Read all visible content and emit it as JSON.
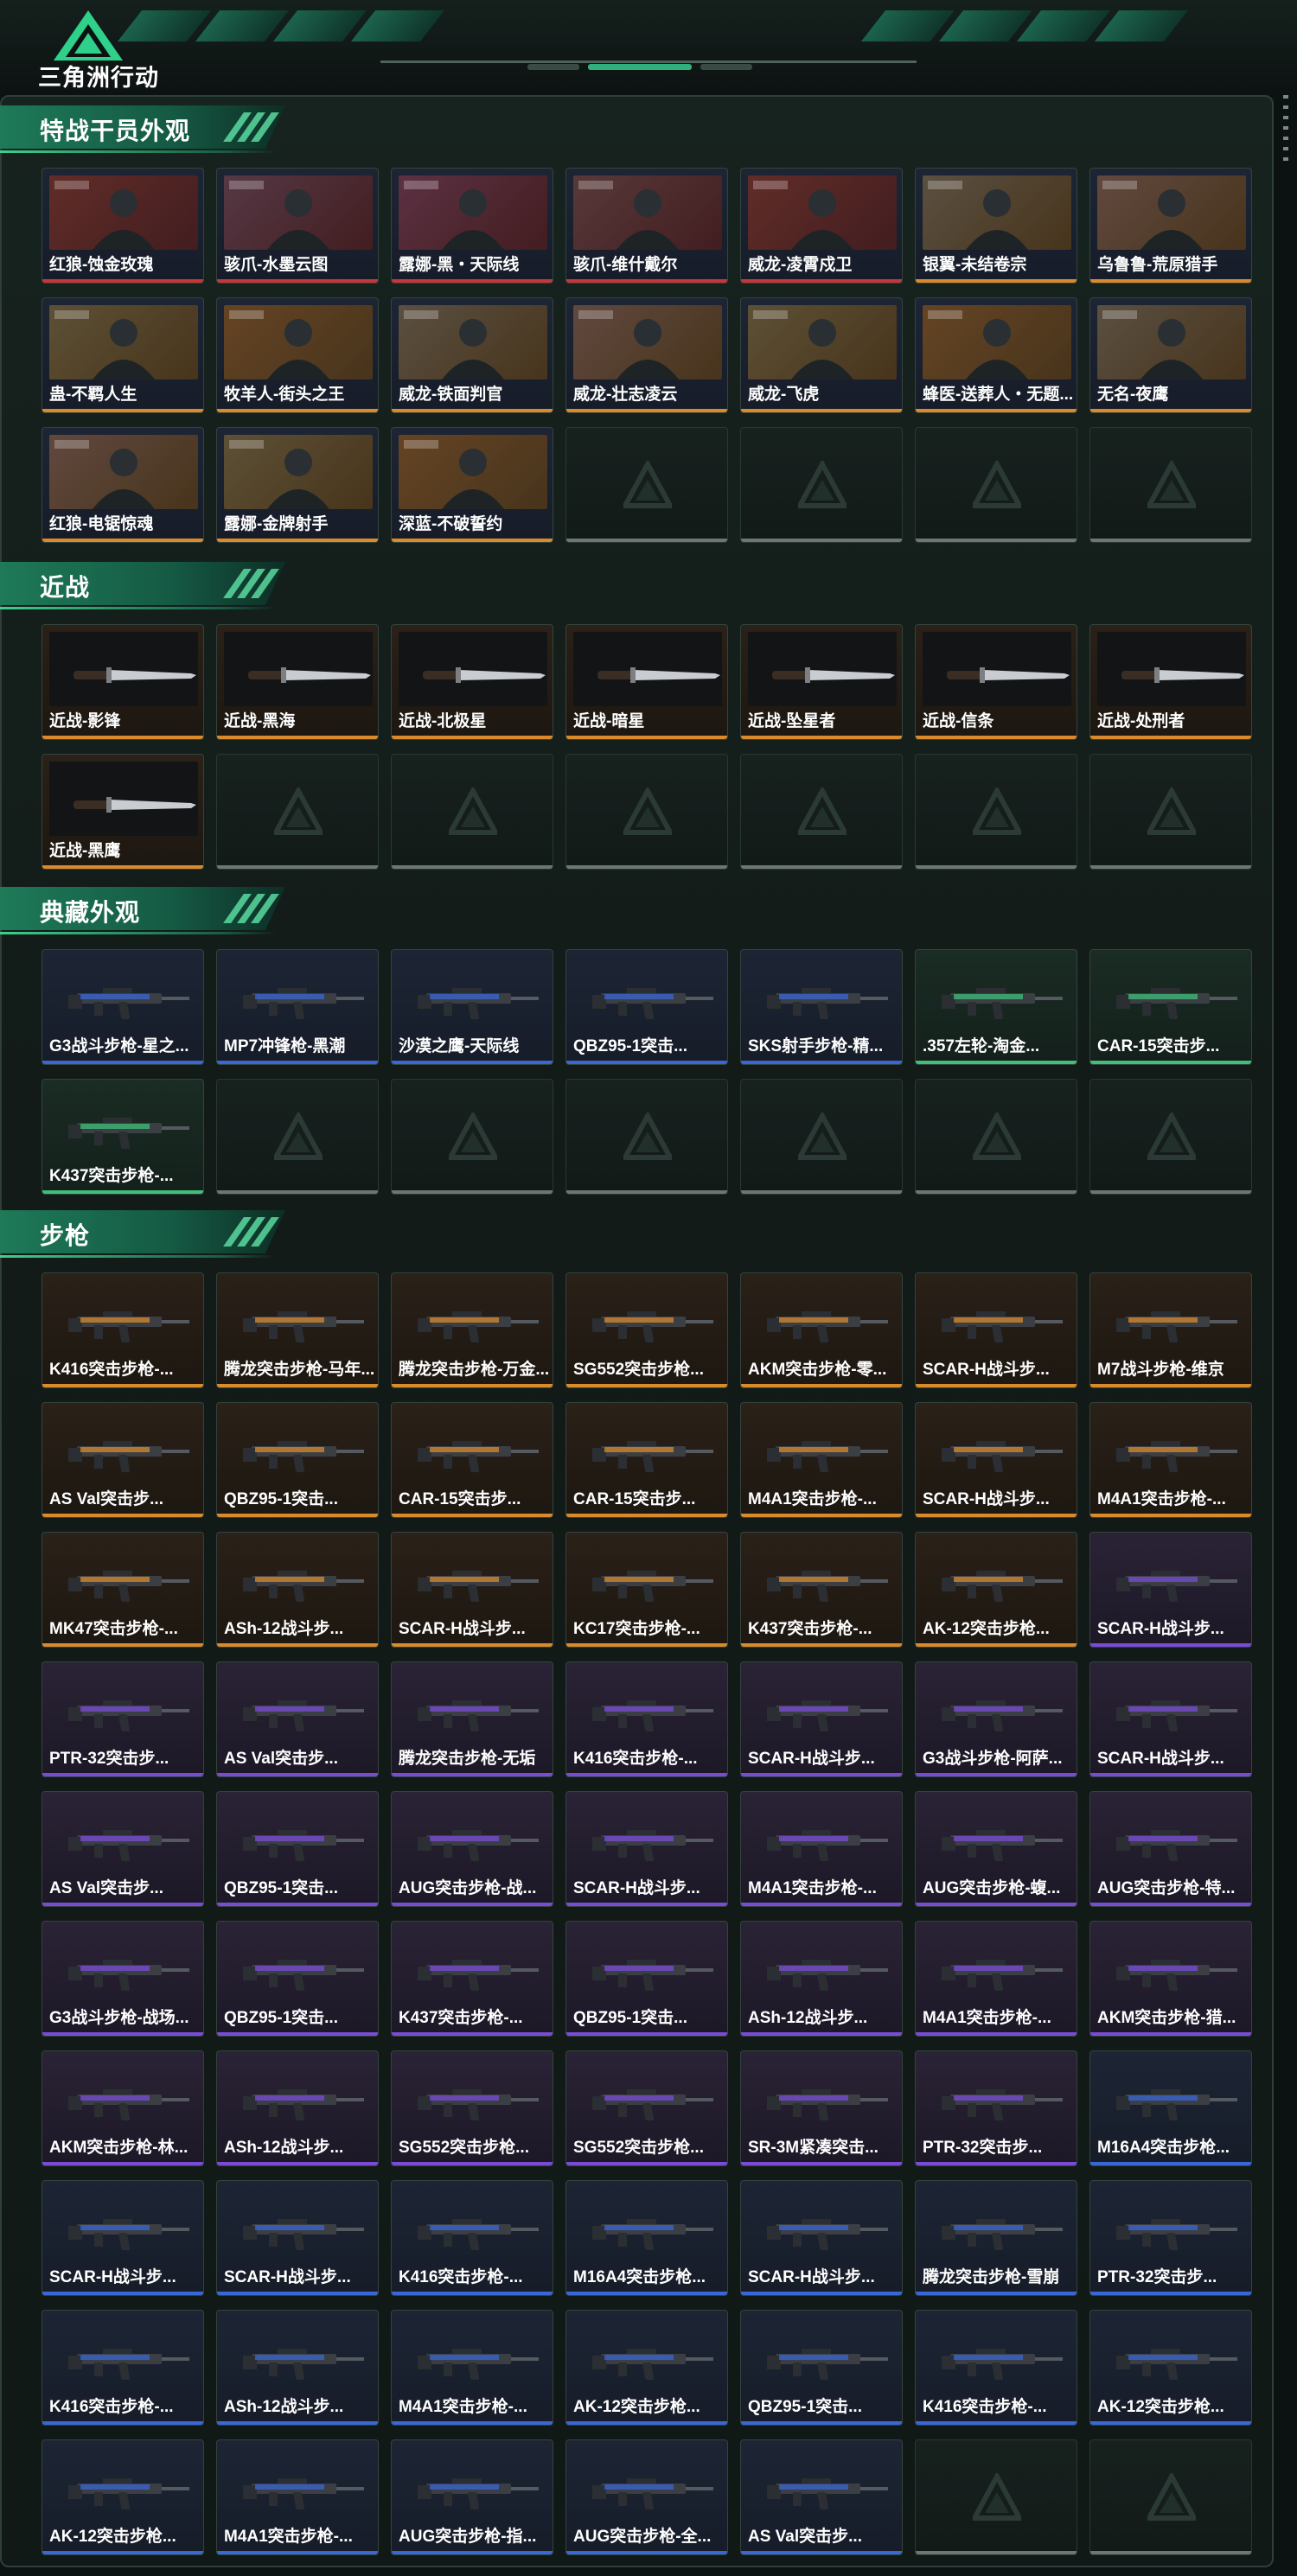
{
  "brand": {
    "name": "三角洲行动"
  },
  "colors": {
    "gold": "#d98a2b",
    "purple": "#7a4cd6",
    "blue": "#3a67d6",
    "green": "#3fbf7a",
    "red": "#c7373a",
    "white": "#b8c2bf"
  },
  "sections": [
    {
      "title": "特战干员外观",
      "kind": "operator",
      "items": [
        {
          "label": "红狼-蚀金玫瑰",
          "rarity": "red",
          "thumb": "portrait"
        },
        {
          "label": "骇爪-水墨云图",
          "rarity": "red",
          "thumb": "portrait"
        },
        {
          "label": "露娜-黑・天际线",
          "rarity": "red",
          "thumb": "portrait"
        },
        {
          "label": "骇爪-维什戴尔",
          "rarity": "red",
          "thumb": "portrait"
        },
        {
          "label": "威龙-凌霄戍卫",
          "rarity": "red",
          "thumb": "portrait"
        },
        {
          "label": "银翼-未结卷宗",
          "rarity": "gold",
          "thumb": "portrait"
        },
        {
          "label": "乌鲁鲁-荒原猎手",
          "rarity": "gold",
          "thumb": "portrait"
        },
        {
          "label": "蛊-不羁人生",
          "rarity": "gold",
          "thumb": "portrait"
        },
        {
          "label": "牧羊人-街头之王",
          "rarity": "gold",
          "thumb": "portrait"
        },
        {
          "label": "威龙-铁面判官",
          "rarity": "gold",
          "thumb": "portrait"
        },
        {
          "label": "威龙-壮志凌云",
          "rarity": "gold",
          "thumb": "portrait"
        },
        {
          "label": "威龙-飞虎",
          "rarity": "gold",
          "thumb": "portrait"
        },
        {
          "label": "蜂医-送葬人・无题...",
          "rarity": "gold",
          "thumb": "portrait"
        },
        {
          "label": "无名-夜鹰",
          "rarity": "gold",
          "thumb": "portrait"
        },
        {
          "label": "红狼-电锯惊魂",
          "rarity": "gold",
          "thumb": "portrait"
        },
        {
          "label": "露娜-金牌射手",
          "rarity": "gold",
          "thumb": "portrait"
        },
        {
          "label": "深蓝-不破誓约",
          "rarity": "gold",
          "thumb": "portrait"
        }
      ],
      "empties": 4
    },
    {
      "title": "近战",
      "kind": "knife",
      "items": [
        {
          "label": "近战-影锋",
          "rarity": "gold"
        },
        {
          "label": "近战-黑海",
          "rarity": "gold"
        },
        {
          "label": "近战-北极星",
          "rarity": "gold"
        },
        {
          "label": "近战-暗星",
          "rarity": "gold"
        },
        {
          "label": "近战-坠星者",
          "rarity": "gold"
        },
        {
          "label": "近战-信条",
          "rarity": "gold"
        },
        {
          "label": "近战-处刑者",
          "rarity": "gold"
        },
        {
          "label": "近战-黑鹰",
          "rarity": "gold"
        }
      ],
      "empties": 6
    },
    {
      "title": "典藏外观",
      "kind": "gun",
      "items": [
        {
          "label": "G3战斗步枪-星之...",
          "rarity": "blue"
        },
        {
          "label": "MP7冲锋枪-黑潮",
          "rarity": "blue"
        },
        {
          "label": "沙漠之鹰-天际线",
          "rarity": "blue"
        },
        {
          "label": "QBZ95-1突击...",
          "rarity": "blue"
        },
        {
          "label": "SKS射手步枪-精...",
          "rarity": "blue"
        },
        {
          "label": ".357左轮-淘金...",
          "rarity": "green"
        },
        {
          "label": "CAR-15突击步...",
          "rarity": "green"
        },
        {
          "label": "K437突击步枪-...",
          "rarity": "green"
        }
      ],
      "empties": 6
    },
    {
      "title": "步枪",
      "kind": "gun",
      "items": [
        {
          "label": "K416突击步枪-...",
          "rarity": "gold"
        },
        {
          "label": "腾龙突击步枪-马年...",
          "rarity": "gold"
        },
        {
          "label": "腾龙突击步枪-万金...",
          "rarity": "gold"
        },
        {
          "label": "SG552突击步枪...",
          "rarity": "gold"
        },
        {
          "label": "AKM突击步枪-零...",
          "rarity": "gold"
        },
        {
          "label": "SCAR-H战斗步...",
          "rarity": "gold"
        },
        {
          "label": "M7战斗步枪-维京",
          "rarity": "gold"
        },
        {
          "label": "AS Val突击步...",
          "rarity": "gold"
        },
        {
          "label": "QBZ95-1突击...",
          "rarity": "gold"
        },
        {
          "label": "CAR-15突击步...",
          "rarity": "gold"
        },
        {
          "label": "CAR-15突击步...",
          "rarity": "gold"
        },
        {
          "label": "M4A1突击步枪-...",
          "rarity": "gold"
        },
        {
          "label": "SCAR-H战斗步...",
          "rarity": "gold"
        },
        {
          "label": "M4A1突击步枪-...",
          "rarity": "gold"
        },
        {
          "label": "MK47突击步枪-...",
          "rarity": "gold"
        },
        {
          "label": "ASh-12战斗步...",
          "rarity": "gold"
        },
        {
          "label": "SCAR-H战斗步...",
          "rarity": "gold"
        },
        {
          "label": "KC17突击步枪-...",
          "rarity": "gold"
        },
        {
          "label": "K437突击步枪-...",
          "rarity": "gold"
        },
        {
          "label": "AK-12突击步枪...",
          "rarity": "gold"
        },
        {
          "label": "SCAR-H战斗步...",
          "rarity": "purple"
        },
        {
          "label": "PTR-32突击步...",
          "rarity": "purple"
        },
        {
          "label": "AS Val突击步...",
          "rarity": "purple"
        },
        {
          "label": "腾龙突击步枪-无垢",
          "rarity": "purple"
        },
        {
          "label": "K416突击步枪-...",
          "rarity": "purple"
        },
        {
          "label": "SCAR-H战斗步...",
          "rarity": "purple"
        },
        {
          "label": "G3战斗步枪-阿萨...",
          "rarity": "purple"
        },
        {
          "label": "SCAR-H战斗步...",
          "rarity": "purple"
        },
        {
          "label": "AS Val突击步...",
          "rarity": "purple"
        },
        {
          "label": "QBZ95-1突击...",
          "rarity": "purple"
        },
        {
          "label": "AUG突击步枪-战...",
          "rarity": "purple"
        },
        {
          "label": "SCAR-H战斗步...",
          "rarity": "purple"
        },
        {
          "label": "M4A1突击步枪-...",
          "rarity": "purple"
        },
        {
          "label": "AUG突击步枪-蝮...",
          "rarity": "purple"
        },
        {
          "label": "AUG突击步枪-特...",
          "rarity": "purple"
        },
        {
          "label": "G3战斗步枪-战场...",
          "rarity": "purple"
        },
        {
          "label": "QBZ95-1突击...",
          "rarity": "purple"
        },
        {
          "label": "K437突击步枪-...",
          "rarity": "purple"
        },
        {
          "label": "QBZ95-1突击...",
          "rarity": "purple"
        },
        {
          "label": "ASh-12战斗步...",
          "rarity": "purple"
        },
        {
          "label": "M4A1突击步枪-...",
          "rarity": "purple"
        },
        {
          "label": "AKM突击步枪-猎...",
          "rarity": "purple"
        },
        {
          "label": "AKM突击步枪-林...",
          "rarity": "purple"
        },
        {
          "label": "ASh-12战斗步...",
          "rarity": "purple"
        },
        {
          "label": "SG552突击步枪...",
          "rarity": "purple"
        },
        {
          "label": "SG552突击步枪...",
          "rarity": "purple"
        },
        {
          "label": "SR-3M紧凑突击...",
          "rarity": "purple"
        },
        {
          "label": "PTR-32突击步...",
          "rarity": "purple"
        },
        {
          "label": "M16A4突击步枪...",
          "rarity": "blue"
        },
        {
          "label": "SCAR-H战斗步...",
          "rarity": "blue"
        },
        {
          "label": "SCAR-H战斗步...",
          "rarity": "blue"
        },
        {
          "label": "K416突击步枪-...",
          "rarity": "blue"
        },
        {
          "label": "M16A4突击步枪...",
          "rarity": "blue"
        },
        {
          "label": "SCAR-H战斗步...",
          "rarity": "blue"
        },
        {
          "label": "腾龙突击步枪-雪崩",
          "rarity": "blue"
        },
        {
          "label": "PTR-32突击步...",
          "rarity": "blue"
        },
        {
          "label": "K416突击步枪-...",
          "rarity": "blue"
        },
        {
          "label": "ASh-12战斗步...",
          "rarity": "blue"
        },
        {
          "label": "M4A1突击步枪-...",
          "rarity": "blue"
        },
        {
          "label": "AK-12突击步枪...",
          "rarity": "blue"
        },
        {
          "label": "QBZ95-1突击...",
          "rarity": "blue"
        },
        {
          "label": "K416突击步枪-...",
          "rarity": "blue"
        },
        {
          "label": "AK-12突击步枪...",
          "rarity": "blue"
        },
        {
          "label": "AK-12突击步枪...",
          "rarity": "blue"
        },
        {
          "label": "M4A1突击步枪-...",
          "rarity": "blue"
        },
        {
          "label": "AUG突击步枪-指...",
          "rarity": "blue"
        },
        {
          "label": "AUG突击步枪-全...",
          "rarity": "blue"
        },
        {
          "label": "AS Val突击步...",
          "rarity": "blue"
        }
      ],
      "empties": 2
    }
  ]
}
